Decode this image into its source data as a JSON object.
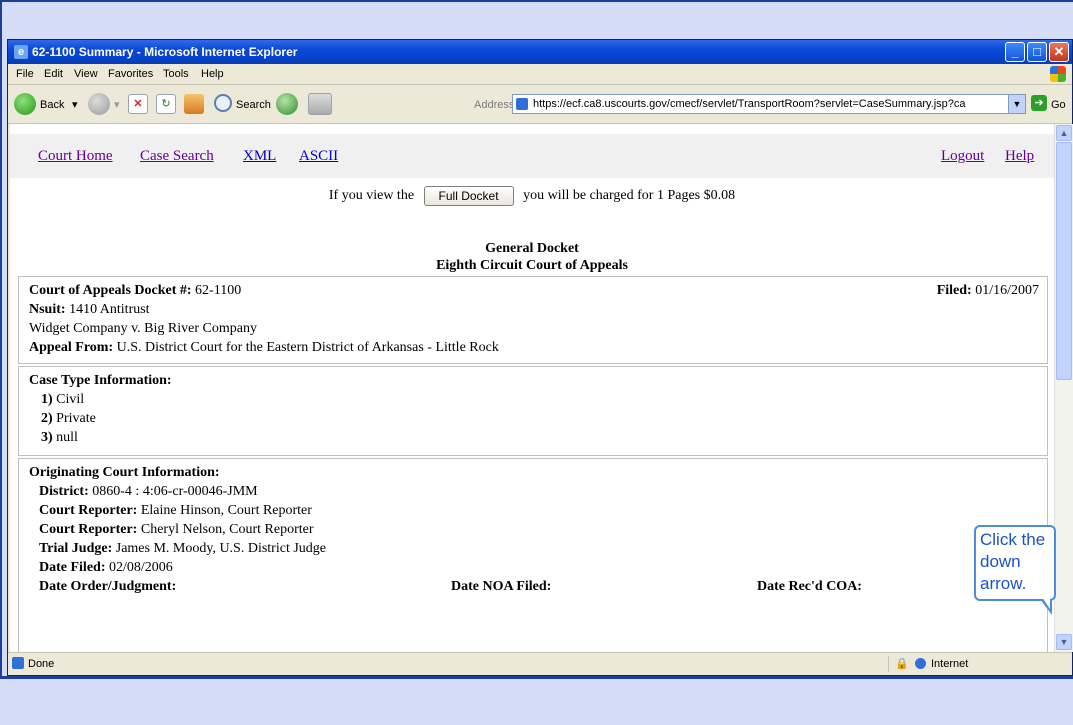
{
  "window": {
    "title": "62-1100 Summary - Microsoft Internet Explorer"
  },
  "menu": {
    "items": [
      "File",
      "Edit",
      "View",
      "Favorites",
      "Tools",
      "Help"
    ]
  },
  "toolbar": {
    "back_label": "Back",
    "search_label": "Search",
    "address_label": "Address",
    "address_value": "https://ecf.ca8.uscourts.gov/cmecf/servlet/TransportRoom?servlet=CaseSummary.jsp?ca",
    "go_label": "Go"
  },
  "nav": {
    "court_home": "Court Home",
    "case_search": "Case Search",
    "xml": "XML",
    "ascii": "ASCII",
    "logout": "Logout",
    "help": "Help"
  },
  "charge": {
    "prefix": "If you view the",
    "button": "Full Docket",
    "suffix": "you will be charged for 1 Pages $0.08"
  },
  "heading": {
    "line1": "General Docket",
    "line2": "Eighth Circuit Court of Appeals"
  },
  "case": {
    "docket_label": "Court of Appeals Docket #:",
    "docket_value": "62-1100",
    "filed_label": "Filed:",
    "filed_value": "01/16/2007",
    "nsuit_label": "Nsuit:",
    "nsuit_value": "1410 Antitrust",
    "parties": "Widget Company v. Big River Company",
    "appeal_label": "Appeal From:",
    "appeal_value": "U.S. District Court for the Eastern District of Arkansas - Little Rock"
  },
  "case_type": {
    "header": "Case Type Information:",
    "items": [
      {
        "num": "1)",
        "text": "Civil"
      },
      {
        "num": "2)",
        "text": "Private"
      },
      {
        "num": "3)",
        "text": "null"
      }
    ]
  },
  "origin": {
    "header": "Originating Court Information:",
    "district_label": "District:",
    "district_value": "0860-4 : 4:06-cr-00046-JMM",
    "reporter1_label": "Court Reporter:",
    "reporter1_value": "Elaine Hinson, Court Reporter",
    "reporter2_label": "Court Reporter:",
    "reporter2_value": "Cheryl Nelson, Court Reporter",
    "judge_label": "Trial Judge:",
    "judge_value": "James M. Moody, U.S. District Judge",
    "date_filed_label": "Date Filed:",
    "date_filed_value": "02/08/2006",
    "order_label": "Date Order/Judgment:",
    "noa_label": "Date NOA Filed:",
    "recd_label": "Date Rec'd COA:"
  },
  "status": {
    "left": "Done",
    "zone": "Internet"
  },
  "callout": {
    "line1": "Click the",
    "line2": "down",
    "line3": "arrow."
  }
}
